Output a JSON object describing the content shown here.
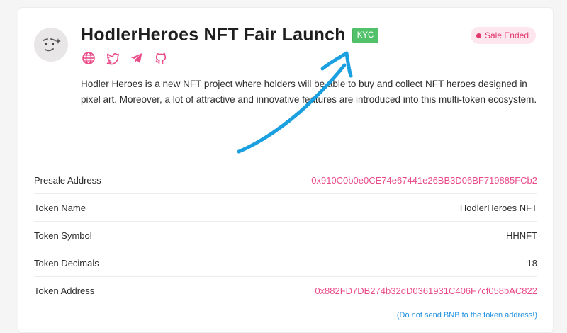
{
  "project": {
    "title": "HodlerHeroes NFT Fair Launch",
    "kyc_badge": "KYC",
    "status": "Sale Ended",
    "description": "Hodler Heroes is a new NFT project where holders will be able to buy and collect NFT heroes designed in pixel art. Moreover, a lot of attractive and innovative features are introduced into this multi-token ecosystem.",
    "socials": [
      "globe-icon",
      "twitter-icon",
      "telegram-icon",
      "github-icon"
    ]
  },
  "details": [
    {
      "label": "Presale Address",
      "value": "0x910C0b0e0CE74e67441e26BB3D06BF719885FCb2"
    },
    {
      "label": "Token Name",
      "value": "HodlerHeroes NFT"
    },
    {
      "label": "Token Symbol",
      "value": "HHNFT"
    },
    {
      "label": "Token Decimals",
      "value": "18"
    },
    {
      "label": "Token Address",
      "value": "0x882FD7DB274b32dD0361931C406F7cf058bAC822"
    }
  ],
  "token_address_note": "(Do not send BNB to the token address!)",
  "colors": {
    "accent": "#ea4c89",
    "kyc_green": "#52c26a",
    "status_bg": "#fde6ee",
    "status_text": "#e2386d",
    "note_blue": "#1e90e0",
    "annotation_arrow": "#1a9fe0"
  }
}
